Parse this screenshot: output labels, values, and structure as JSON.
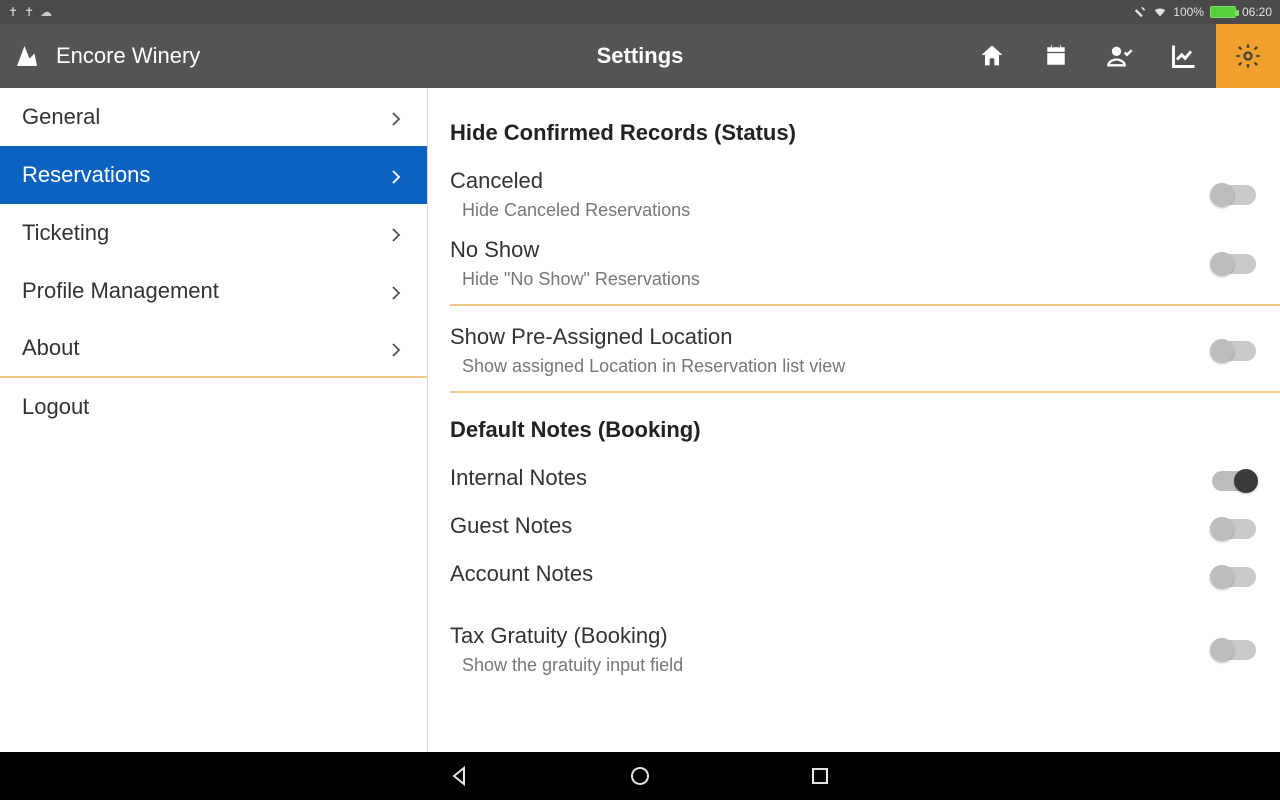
{
  "status": {
    "battery_pct": "100%",
    "time": "06:20"
  },
  "appbar": {
    "brand": "Encore Winery",
    "title": "Settings"
  },
  "sidebar": {
    "items": [
      {
        "label": "General"
      },
      {
        "label": "Reservations"
      },
      {
        "label": "Ticketing"
      },
      {
        "label": "Profile Management"
      },
      {
        "label": "About"
      },
      {
        "label": "Logout"
      }
    ]
  },
  "content": {
    "section1_header": "Hide Confirmed Records (Status)",
    "rows": [
      {
        "title": "Canceled",
        "sub": "Hide Canceled Reservations",
        "on": false
      },
      {
        "title": "No Show",
        "sub": "Hide \"No Show\" Reservations",
        "on": false
      }
    ],
    "pre_assigned": {
      "title": "Show Pre-Assigned Location",
      "sub": "Show assigned Location in Reservation list view",
      "on": false
    },
    "section2_header": "Default Notes (Booking)",
    "notes": [
      {
        "title": "Internal Notes",
        "on": true
      },
      {
        "title": "Guest Notes",
        "on": false
      },
      {
        "title": "Account Notes",
        "on": false
      }
    ],
    "tax": {
      "title": "Tax Gratuity (Booking)",
      "sub": "Show the gratuity input field",
      "on": false
    }
  }
}
